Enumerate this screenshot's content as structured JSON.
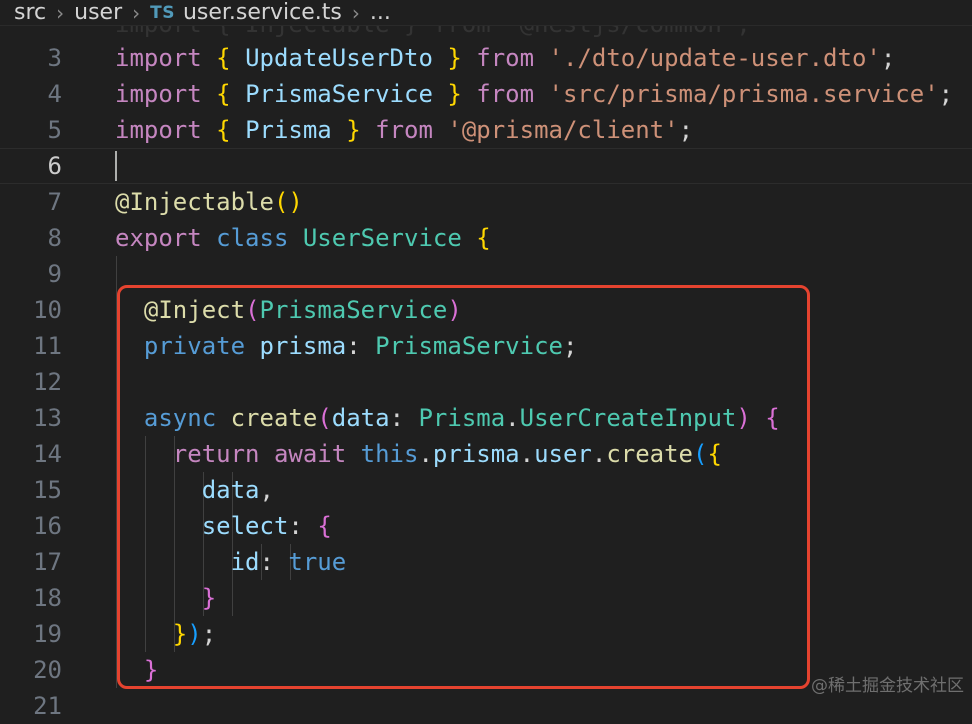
{
  "breadcrumb": {
    "items": [
      "src",
      "user",
      "user.service.ts",
      "..."
    ],
    "file_badge": "TS"
  },
  "watermark": "@稀土掘金技术社区",
  "editor": {
    "ghost_line": "import { Injectable } from '@nestjs/common';",
    "lines": [
      {
        "n": "3",
        "tokens": [
          {
            "t": "import",
            "c": "kw-ctrl"
          },
          {
            "t": " "
          },
          {
            "t": "{",
            "c": "b1"
          },
          {
            "t": " "
          },
          {
            "t": "UpdateUserDto",
            "c": "var"
          },
          {
            "t": " "
          },
          {
            "t": "}",
            "c": "b1"
          },
          {
            "t": " "
          },
          {
            "t": "from",
            "c": "kw-ctrl"
          },
          {
            "t": " "
          },
          {
            "t": "'./dto/update-user.dto'",
            "c": "str"
          },
          {
            "t": ";",
            "c": "punc"
          }
        ]
      },
      {
        "n": "4",
        "tokens": [
          {
            "t": "import",
            "c": "kw-ctrl"
          },
          {
            "t": " "
          },
          {
            "t": "{",
            "c": "b1"
          },
          {
            "t": " "
          },
          {
            "t": "PrismaService",
            "c": "var"
          },
          {
            "t": " "
          },
          {
            "t": "}",
            "c": "b1"
          },
          {
            "t": " "
          },
          {
            "t": "from",
            "c": "kw-ctrl"
          },
          {
            "t": " "
          },
          {
            "t": "'src/prisma/prisma.service'",
            "c": "str"
          },
          {
            "t": ";",
            "c": "punc"
          }
        ]
      },
      {
        "n": "5",
        "tokens": [
          {
            "t": "import",
            "c": "kw-ctrl"
          },
          {
            "t": " "
          },
          {
            "t": "{",
            "c": "b1"
          },
          {
            "t": " "
          },
          {
            "t": "Prisma",
            "c": "var"
          },
          {
            "t": " "
          },
          {
            "t": "}",
            "c": "b1"
          },
          {
            "t": " "
          },
          {
            "t": "from",
            "c": "kw-ctrl"
          },
          {
            "t": " "
          },
          {
            "t": "'@prisma/client'",
            "c": "str"
          },
          {
            "t": ";",
            "c": "punc"
          }
        ]
      },
      {
        "n": "6",
        "active": true,
        "tokens": []
      },
      {
        "n": "7",
        "tokens": [
          {
            "t": "@",
            "c": "fn"
          },
          {
            "t": "Injectable",
            "c": "fn"
          },
          {
            "t": "(",
            "c": "b1"
          },
          {
            "t": ")",
            "c": "b1"
          }
        ]
      },
      {
        "n": "8",
        "tokens": [
          {
            "t": "export",
            "c": "kw-ctrl"
          },
          {
            "t": " "
          },
          {
            "t": "class",
            "c": "kw"
          },
          {
            "t": " "
          },
          {
            "t": "UserService",
            "c": "cls"
          },
          {
            "t": " "
          },
          {
            "t": "{",
            "c": "b1"
          }
        ]
      },
      {
        "n": "9",
        "tokens": []
      },
      {
        "n": "10",
        "tokens": [
          {
            "t": "  "
          },
          {
            "t": "@",
            "c": "fn"
          },
          {
            "t": "Inject",
            "c": "fn"
          },
          {
            "t": "(",
            "c": "b2"
          },
          {
            "t": "PrismaService",
            "c": "cls"
          },
          {
            "t": ")",
            "c": "b2"
          }
        ]
      },
      {
        "n": "11",
        "tokens": [
          {
            "t": "  "
          },
          {
            "t": "private",
            "c": "kw"
          },
          {
            "t": " "
          },
          {
            "t": "prisma",
            "c": "var"
          },
          {
            "t": ": ",
            "c": "punc"
          },
          {
            "t": "PrismaService",
            "c": "cls"
          },
          {
            "t": ";",
            "c": "punc"
          }
        ]
      },
      {
        "n": "12",
        "tokens": []
      },
      {
        "n": "13",
        "tokens": [
          {
            "t": "  "
          },
          {
            "t": "async",
            "c": "kw"
          },
          {
            "t": " "
          },
          {
            "t": "create",
            "c": "fn"
          },
          {
            "t": "(",
            "c": "b2"
          },
          {
            "t": "data",
            "c": "var"
          },
          {
            "t": ": ",
            "c": "punc"
          },
          {
            "t": "Prisma",
            "c": "cls"
          },
          {
            "t": ".",
            "c": "punc"
          },
          {
            "t": "UserCreateInput",
            "c": "cls"
          },
          {
            "t": ")",
            "c": "b2"
          },
          {
            "t": " "
          },
          {
            "t": "{",
            "c": "b2"
          }
        ]
      },
      {
        "n": "14",
        "tokens": [
          {
            "t": "    "
          },
          {
            "t": "return",
            "c": "kw-ctrl"
          },
          {
            "t": " "
          },
          {
            "t": "await",
            "c": "kw-ctrl"
          },
          {
            "t": " "
          },
          {
            "t": "this",
            "c": "kw"
          },
          {
            "t": ".",
            "c": "punc"
          },
          {
            "t": "prisma",
            "c": "var"
          },
          {
            "t": ".",
            "c": "punc"
          },
          {
            "t": "user",
            "c": "var"
          },
          {
            "t": ".",
            "c": "punc"
          },
          {
            "t": "create",
            "c": "fn"
          },
          {
            "t": "(",
            "c": "b3"
          },
          {
            "t": "{",
            "c": "b1"
          }
        ]
      },
      {
        "n": "15",
        "tokens": [
          {
            "t": "      "
          },
          {
            "t": "data",
            "c": "var"
          },
          {
            "t": ",",
            "c": "punc"
          }
        ]
      },
      {
        "n": "16",
        "tokens": [
          {
            "t": "      "
          },
          {
            "t": "select",
            "c": "var"
          },
          {
            "t": ": ",
            "c": "punc"
          },
          {
            "t": "{",
            "c": "b2"
          }
        ]
      },
      {
        "n": "17",
        "tokens": [
          {
            "t": "        "
          },
          {
            "t": "id",
            "c": "var"
          },
          {
            "t": ": ",
            "c": "punc"
          },
          {
            "t": "true",
            "c": "kw"
          }
        ]
      },
      {
        "n": "18",
        "tokens": [
          {
            "t": "      "
          },
          {
            "t": "}",
            "c": "b2"
          }
        ]
      },
      {
        "n": "19",
        "tokens": [
          {
            "t": "    "
          },
          {
            "t": "}",
            "c": "b1"
          },
          {
            "t": ")",
            "c": "b3"
          },
          {
            "t": ";",
            "c": "punc"
          }
        ]
      },
      {
        "n": "20",
        "tokens": [
          {
            "t": "  "
          },
          {
            "t": "}",
            "c": "b2"
          }
        ]
      },
      {
        "n": "21",
        "tokens": []
      }
    ]
  }
}
